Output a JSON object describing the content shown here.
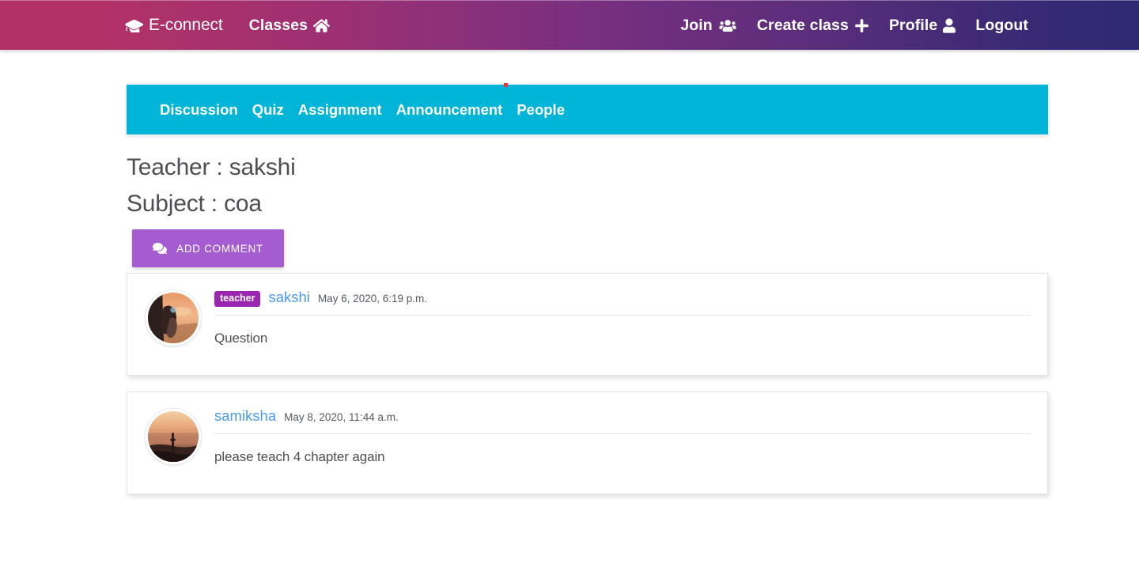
{
  "navbar": {
    "brand": "E-connect",
    "brand_icon": "graduation-cap-icon",
    "left_links": [
      {
        "label": "Classes",
        "icon": "home-icon"
      }
    ],
    "right_links": [
      {
        "label": "Join",
        "icon": "users-icon"
      },
      {
        "label": "Create class",
        "icon": "plus-icon"
      },
      {
        "label": "Profile",
        "icon": "user-icon"
      },
      {
        "label": "Logout",
        "icon": ""
      }
    ],
    "gradient_start": "#b23267",
    "gradient_mid": "#7b2f7f",
    "gradient_end": "#2e2a72"
  },
  "tabbar": {
    "background": "#00b5d8",
    "tabs": [
      {
        "label": "Discussion"
      },
      {
        "label": "Quiz"
      },
      {
        "label": "Assignment"
      },
      {
        "label": "Announcement"
      },
      {
        "label": "People"
      }
    ]
  },
  "header": {
    "teacher": "Teacher : sakshi",
    "subject": "Subject : coa"
  },
  "actions": {
    "add_comment_label": "ADD COMMENT",
    "add_comment_icon": "comments-icon",
    "add_comment_color": "#a45cd0"
  },
  "comments": [
    {
      "badge": "teacher",
      "badge_color": "#9b27b0",
      "author": "sakshi",
      "author_color": "#4a9bf0",
      "timestamp": "May 6, 2020, 6:19 p.m.",
      "body": "Question",
      "avatar": "avatar-sunset-person-photo"
    },
    {
      "badge": "",
      "badge_color": "#9b27b0",
      "author": "samiksha",
      "author_color": "#4a9bf0",
      "timestamp": "May 8, 2020, 11:44 a.m.",
      "body": "please teach 4 chapter again",
      "avatar": "avatar-sunset-skyline-photo"
    }
  ]
}
